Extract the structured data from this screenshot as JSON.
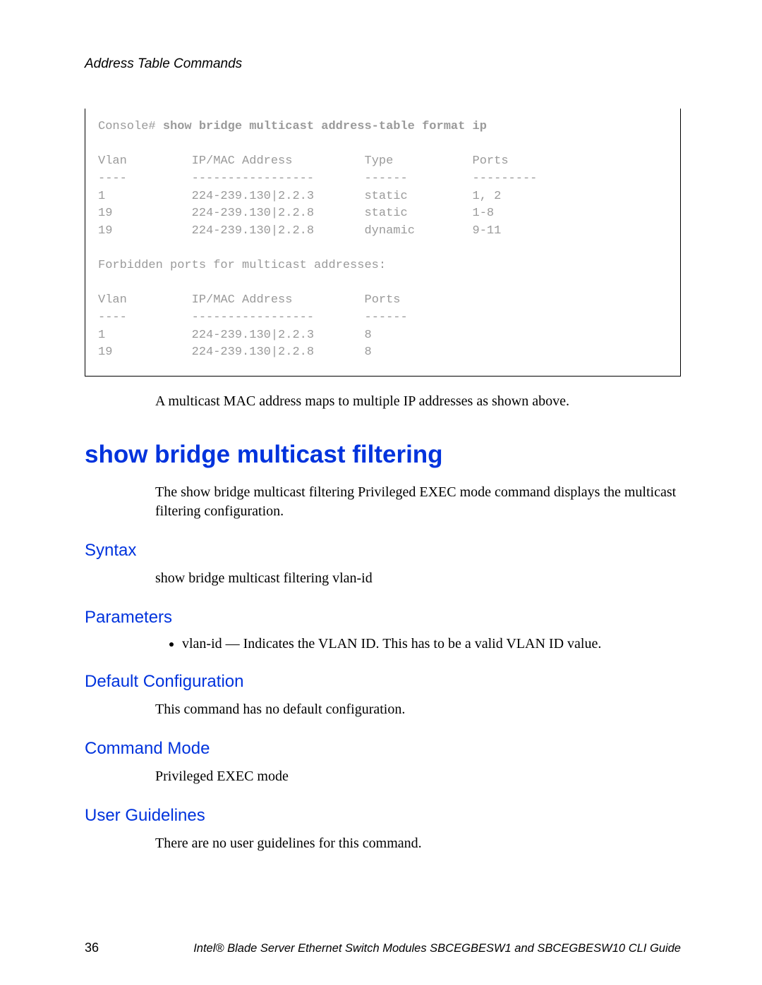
{
  "header": {
    "running": "Address Table Commands"
  },
  "code": {
    "prompt": "Console# ",
    "command": "show bridge multicast address-table format ip",
    "table1": {
      "headers": [
        "Vlan",
        "IP/MAC Address",
        "Type",
        "Ports"
      ],
      "sep": [
        "----",
        "-----------------",
        "------",
        "---------"
      ],
      "rows": [
        [
          "1",
          "224-239.130|2.2.3",
          "static",
          "1, 2"
        ],
        [
          "19",
          "224-239.130|2.2.8",
          "static",
          "1-8"
        ],
        [
          "19",
          "224-239.130|2.2.8",
          "dynamic",
          "9-11"
        ]
      ]
    },
    "forbidden_label": "Forbidden ports for multicast addresses:",
    "table2": {
      "headers": [
        "Vlan",
        "IP/MAC Address",
        "Ports"
      ],
      "sep": [
        "----",
        "-----------------",
        "------"
      ],
      "rows": [
        [
          "1",
          "224-239.130|2.2.3",
          "8"
        ],
        [
          "19",
          "224-239.130|2.2.8",
          "8"
        ]
      ]
    }
  },
  "note_below_box": "A multicast MAC address maps to multiple IP addresses as shown above.",
  "section": {
    "title": "show bridge multicast filtering",
    "intro": "The show bridge multicast filtering Privileged EXEC mode command displays the multicast filtering configuration.",
    "syntax_h": "Syntax",
    "syntax_body": "show bridge multicast filtering vlan-id",
    "params_h": "Parameters",
    "params_item": "vlan-id — Indicates the VLAN ID. This has to be a valid VLAN ID value.",
    "default_h": "Default Configuration",
    "default_body": "This command has no default configuration.",
    "mode_h": "Command Mode",
    "mode_body": "Privileged EXEC mode",
    "guidelines_h": "User Guidelines",
    "guidelines_body": "There are no user guidelines for this command."
  },
  "footer": {
    "page": "36",
    "guide": "Intel® Blade Server Ethernet Switch Modules SBCEGBESW1 and SBCEGBESW10 CLI Guide"
  }
}
